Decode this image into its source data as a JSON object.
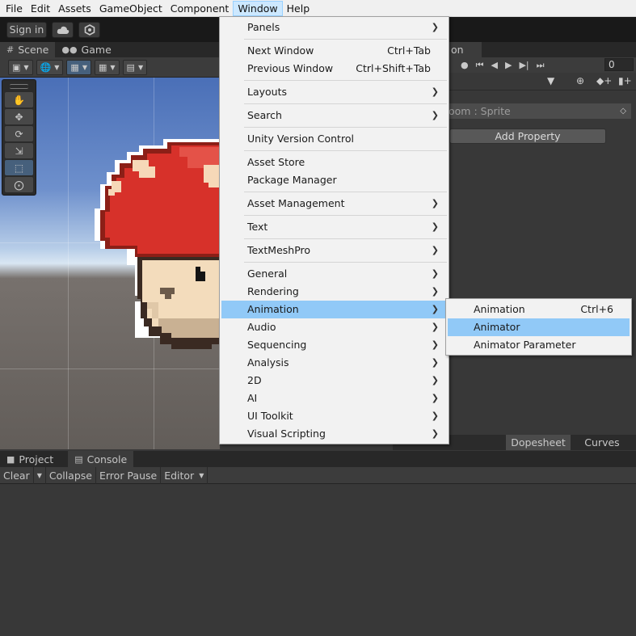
{
  "menubar": {
    "items": [
      "File",
      "Edit",
      "Assets",
      "GameObject",
      "Component",
      "Window",
      "Help"
    ],
    "open_item": "Window"
  },
  "toolbar": {
    "sign_in": "Sign in",
    "cloud_icon": "cloud-icon",
    "collab_icon": "collab-icon"
  },
  "scene_tabs": [
    {
      "label": "Scene",
      "icon": "hash-icon"
    },
    {
      "label": "Game",
      "icon": "gamepad-icon"
    }
  ],
  "animation_panel": {
    "tab_label_fragment": "on",
    "frame_value": "0",
    "property_label": "oom : Sprite",
    "add_property": "Add Property",
    "dopesheet": "Dopesheet",
    "curves": "Curves"
  },
  "bottom_tabs": [
    {
      "label": "Project",
      "icon": "folder-icon"
    },
    {
      "label": "Console",
      "icon": "console-icon"
    }
  ],
  "console_toolbar": {
    "clear": "Clear",
    "collapse": "Collapse",
    "error_pause": "Error Pause",
    "editor": "Editor"
  },
  "window_menu": {
    "items": [
      {
        "label": "Panels",
        "submenu": true
      },
      {
        "label": "Next Window",
        "shortcut": "Ctrl+Tab"
      },
      {
        "label": "Previous Window",
        "shortcut": "Ctrl+Shift+Tab"
      },
      {
        "label": "Layouts",
        "submenu": true
      },
      {
        "label": "Search",
        "submenu": true
      },
      {
        "label": "Unity Version Control"
      },
      {
        "label": "Asset Store"
      },
      {
        "label": "Package Manager"
      },
      {
        "label": "Asset Management",
        "submenu": true
      },
      {
        "label": "Text",
        "submenu": true
      },
      {
        "label": "TextMeshPro",
        "submenu": true
      },
      {
        "label": "General",
        "submenu": true
      },
      {
        "label": "Rendering",
        "submenu": true
      },
      {
        "label": "Animation",
        "submenu": true,
        "highlighted": true
      },
      {
        "label": "Audio",
        "submenu": true
      },
      {
        "label": "Sequencing",
        "submenu": true
      },
      {
        "label": "Analysis",
        "submenu": true
      },
      {
        "label": "2D",
        "submenu": true
      },
      {
        "label": "AI",
        "submenu": true
      },
      {
        "label": "UI Toolkit",
        "submenu": true
      },
      {
        "label": "Visual Scripting",
        "submenu": true
      }
    ]
  },
  "animation_submenu": {
    "items": [
      {
        "label": "Animation",
        "shortcut": "Ctrl+6"
      },
      {
        "label": "Animator",
        "highlighted": true
      },
      {
        "label": "Animator Parameter"
      }
    ]
  },
  "colors": {
    "menu_highlight": "#91c9f7",
    "editor_bg": "#383838",
    "active_tool": "#46607c"
  }
}
